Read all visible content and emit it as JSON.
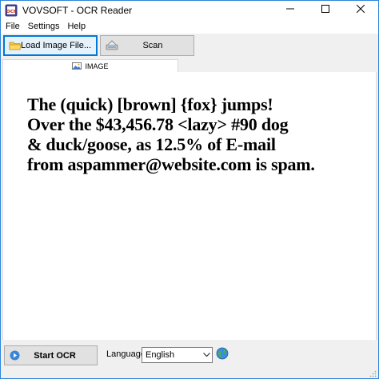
{
  "window": {
    "title": "VOVSOFT - OCR Reader",
    "controls": [
      "minimize-icon",
      "maximize-icon",
      "close-icon"
    ]
  },
  "menu": {
    "items": [
      "File",
      "Settings",
      "Help"
    ]
  },
  "toolbar": {
    "load_label": "Load Image File...",
    "scan_label": "Scan",
    "load_icon": "folder-icon",
    "scan_icon": "scanner-icon"
  },
  "tabs": [
    {
      "label": "IMAGE",
      "icon": "image-icon",
      "active": true
    }
  ],
  "image": {
    "lines": [
      "The (quick) [brown] {fox} jumps!",
      "Over the $43,456.78 <lazy> #90 dog",
      "& duck/goose, as 12.5% of E-mail",
      "from aspammer@website.com is spam."
    ]
  },
  "bottom": {
    "start_label": "Start OCR",
    "start_icon": "play-icon",
    "language_label": "Language:",
    "language_value": "English",
    "globe_icon": "globe-icon"
  },
  "colors": {
    "accent": "#0078d7",
    "window_border": "#2b86d9",
    "face": "#f0f0f0"
  }
}
